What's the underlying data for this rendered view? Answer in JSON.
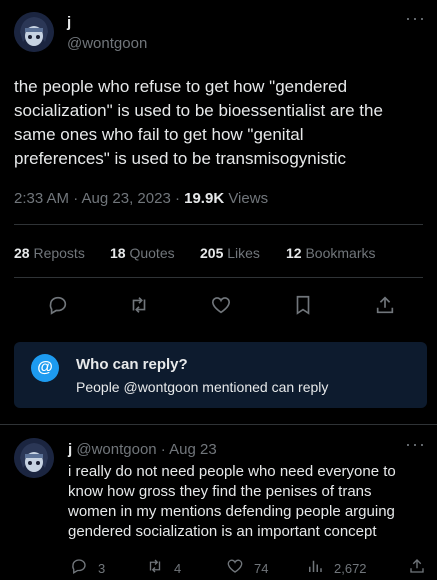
{
  "tweet": {
    "author_name": "j",
    "author_handle": "@wontgoon",
    "more_icon": "more-icon",
    "text": "the people who refuse to get how \"gendered\nsocialization\" is used to be bioessentialist are the\nsame ones who fail to get how \"genital\npreferences\" is used to be transmisogynistic",
    "time": "2:33 AM · Aug 23, 2023 · ",
    "views_count": "19.9K",
    "views_label": " Views"
  },
  "stats": [
    {
      "count": "28",
      "label": " Reposts"
    },
    {
      "count": "18",
      "label": " Quotes"
    },
    {
      "count": "205",
      "label": " Likes"
    },
    {
      "count": "12",
      "label": " Bookmarks"
    }
  ],
  "actions": [
    "reply-icon",
    "repost-icon",
    "like-icon",
    "bookmark-icon",
    "share-icon"
  ],
  "who_can_reply": {
    "icon": "@",
    "title": "Who can reply?",
    "subtitle": "People @wontgoon mentioned can reply"
  },
  "reply": {
    "author_name": "j",
    "author_handle": "@wontgoon",
    "date": "· Aug 23",
    "text": "i really do not need people who need everyone to\nknow how gross they find the penises of trans\nwomen in my mentions defending people arguing\ngendered socialization is an important concept",
    "replies": "3",
    "reposts": "4",
    "likes": "74",
    "views": "2,672"
  },
  "colors": {
    "background": "#000000",
    "text": "#e7e9ea",
    "muted": "#71767b",
    "accent": "#1d9bf0",
    "reply_box": "#0d1b2e"
  }
}
